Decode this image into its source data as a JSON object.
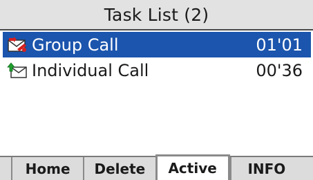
{
  "title": "Task List (2)",
  "tasks": [
    {
      "icon": "group-call-envelope-icon",
      "name": "Group Call",
      "time": "01'01",
      "selected": true
    },
    {
      "icon": "individual-call-envelope-icon",
      "name": "Individual Call",
      "time": "00'36",
      "selected": false
    }
  ],
  "softkeys": [
    "Home",
    "Delete",
    "Active",
    "INFO"
  ],
  "colors": {
    "highlight": "#1b55ad",
    "title_bg": "#e2e2e2"
  }
}
